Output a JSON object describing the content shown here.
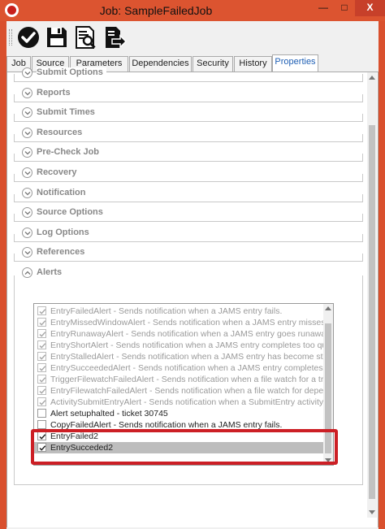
{
  "window": {
    "title": "Job: SampleFailedJob",
    "minimize_glyph": "—",
    "maximize_glyph": "□",
    "close_glyph": "X"
  },
  "toolbar": {
    "tools": [
      "check-circle-icon",
      "save-icon",
      "view-document-icon",
      "export-document-icon"
    ]
  },
  "tabs": [
    {
      "label": "Job",
      "active": false
    },
    {
      "label": "Source",
      "active": false
    },
    {
      "label": "Parameters",
      "active": false
    },
    {
      "label": "Dependencies",
      "active": false
    },
    {
      "label": "Security",
      "active": false
    },
    {
      "label": "History",
      "active": false
    },
    {
      "label": "Properties",
      "active": true
    }
  ],
  "sections": [
    {
      "label": "Submit Options",
      "state": "collapsed"
    },
    {
      "label": "Reports",
      "state": "collapsed"
    },
    {
      "label": "Submit Times",
      "state": "collapsed"
    },
    {
      "label": "Resources",
      "state": "collapsed"
    },
    {
      "label": "Pre-Check Job",
      "state": "collapsed"
    },
    {
      "label": "Recovery",
      "state": "collapsed"
    },
    {
      "label": "Notification",
      "state": "collapsed"
    },
    {
      "label": "Source Options",
      "state": "collapsed"
    },
    {
      "label": "Log Options",
      "state": "collapsed"
    },
    {
      "label": "References",
      "state": "collapsed"
    },
    {
      "label": "Alerts",
      "state": "expanded"
    }
  ],
  "alerts": [
    {
      "text": "EntryFailedAlert - Sends notification when a JAMS entry fails.",
      "checked": true,
      "disabled": true
    },
    {
      "text": "EntryMissedWindowAlert - Sends notification when a JAMS entry misses it's sched",
      "checked": true,
      "disabled": true
    },
    {
      "text": "EntryRunawayAlert - Sends notification when a JAMS entry goes runaway.",
      "checked": true,
      "disabled": true
    },
    {
      "text": "EntryShortAlert - Sends notification when a JAMS entry completes too quickly.",
      "checked": true,
      "disabled": true
    },
    {
      "text": "EntryStalledAlert - Sends notification when a JAMS entry has become stalled.",
      "checked": true,
      "disabled": true
    },
    {
      "text": "EntrySucceededAlert - Sends notification when a JAMS entry completes successful",
      "checked": true,
      "disabled": true
    },
    {
      "text": "TriggerFilewatchFailedAlert - Sends notification when a file watch for a trigger eve",
      "checked": true,
      "disabled": true
    },
    {
      "text": "EntryFilewatchFailedAlert - Sends notification when a file watch for dependency fa",
      "checked": true,
      "disabled": true
    },
    {
      "text": "ActivitySubmitEntryAlert - Sends notification when a SubmitEntry activity fails duri",
      "checked": true,
      "disabled": true
    },
    {
      "text": "Alert setuphalted - ticket 30745",
      "checked": false,
      "disabled": false
    },
    {
      "text": "CopyFailedAlert - Sends notification when a JAMS entry fails.",
      "checked": false,
      "disabled": false
    },
    {
      "text": "EntryFailed2",
      "checked": true,
      "disabled": false
    },
    {
      "text": "EntrySucceded2",
      "checked": true,
      "disabled": false,
      "selected": true
    }
  ],
  "colors": {
    "accent": "#1e5fb4",
    "highlight_border": "#cc1f25",
    "title_bar": "#dc5430"
  }
}
